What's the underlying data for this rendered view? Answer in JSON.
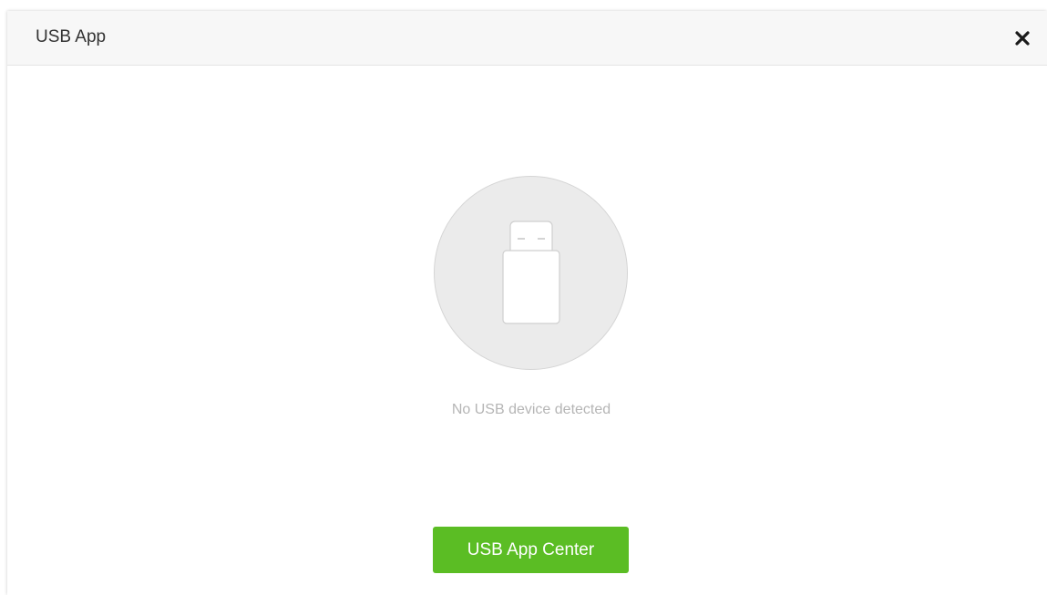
{
  "dialog": {
    "title": "USB App",
    "close_icon": "close-icon"
  },
  "main": {
    "illustration_icon": "usb-drive-icon",
    "status_text": "No USB device detected",
    "app_center_button_label": "USB App Center"
  },
  "colors": {
    "header_background": "#f7f7f7",
    "circle_background": "#ebebeb",
    "status_text": "#b5b5b5",
    "button_background": "#5bbd24",
    "button_text": "#ffffff"
  }
}
